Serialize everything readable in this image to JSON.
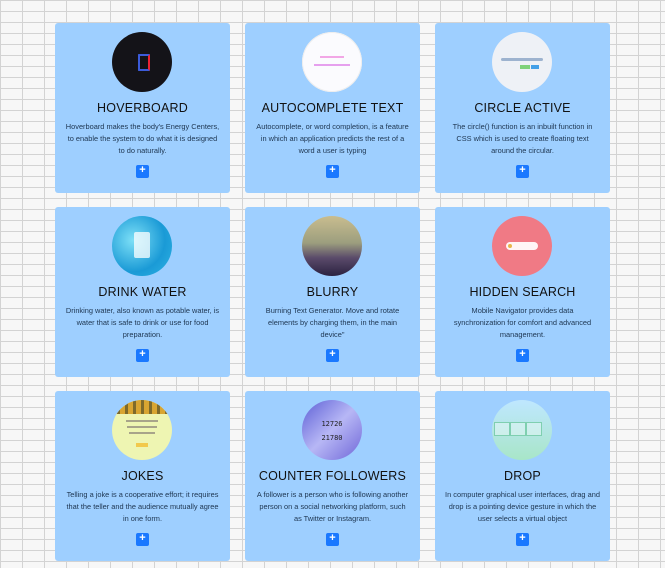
{
  "cards": [
    {
      "title": "HOVERBOARD",
      "desc": "Hoverboard makes the body's Energy Centers, to enable the system to do what it is designed to do naturally.",
      "button": "+"
    },
    {
      "title": "AUTOCOMPLETE TEXT",
      "desc": "Autocomplete, or word completion, is a feature in which an application predicts the rest of a word a user is typing",
      "button": "+"
    },
    {
      "title": "CIRCLE ACTIVE",
      "desc": "The circle() function is an inbuilt function in CSS which is used to create floating text around the circular.",
      "button": "+"
    },
    {
      "title": "DRINK WATER",
      "desc": "Drinking water, also known as potable water, is water that is safe to drink or use for food preparation.",
      "button": "+"
    },
    {
      "title": "BLURRY",
      "desc": "Burning Text Generator. Move and rotate elements by charging them, in the main device\"",
      "button": "+"
    },
    {
      "title": "HIDDEN SEARCH",
      "desc": "Mobile Navigator provides data synchronization for comfort and advanced management.",
      "button": "+"
    },
    {
      "title": "JOKES",
      "desc": "Telling a joke is a cooperative effort; it requires that the teller and the audience mutually agree in one form.",
      "button": "+"
    },
    {
      "title": "COUNTER FOLLOWERS",
      "desc": "A follower is a person who is following another person on a social networking platform, such as Twitter or Instagram.",
      "button": "+"
    },
    {
      "title": "DROP",
      "desc": "In computer graphical user interfaces, drag and drop is a pointing device gesture in which the user selects a virtual object",
      "button": "+"
    }
  ],
  "thumb_text": {
    "counter_top": "12726",
    "counter_bottom": "21780"
  }
}
